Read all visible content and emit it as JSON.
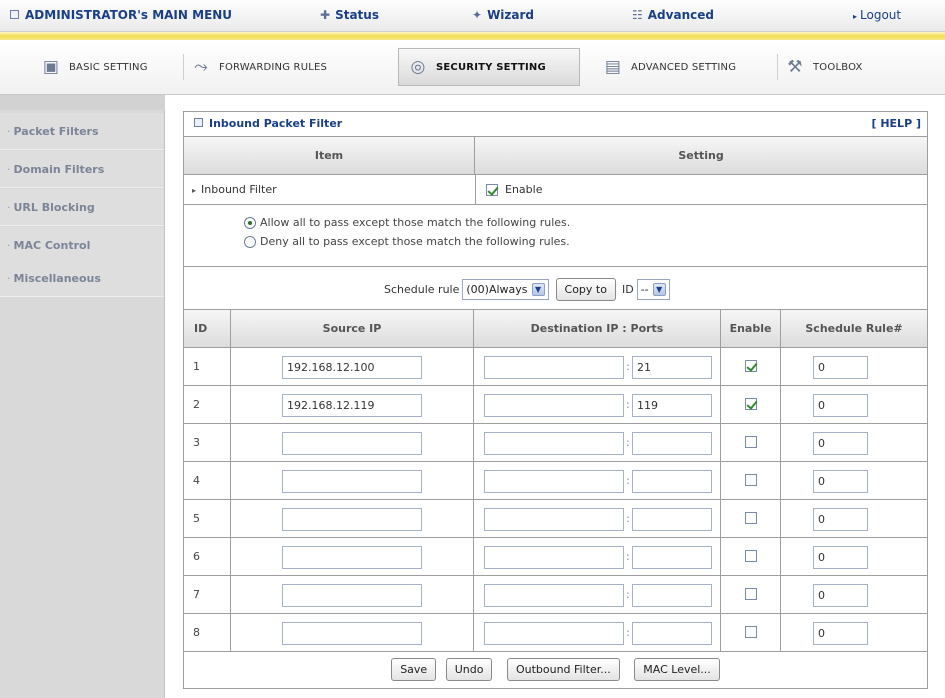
{
  "topbar": {
    "title": "ADMINISTRATOR's MAIN MENU",
    "status": "Status",
    "wizard": "Wizard",
    "advanced": "Advanced",
    "logout": "Logout"
  },
  "tabs": {
    "basic": "BASIC SETTING",
    "forwarding": "FORWARDING RULES",
    "security": "SECURITY SETTING",
    "advanced": "ADVANCED SETTING",
    "toolbox": "TOOLBOX",
    "active": "security"
  },
  "sidebar": {
    "items": [
      {
        "label": "Packet Filters"
      },
      {
        "label": "Domain Filters"
      },
      {
        "label": "URL Blocking"
      },
      {
        "label": "MAC Control"
      },
      {
        "label": "Miscellaneous"
      }
    ]
  },
  "panel": {
    "title": "Inbound Packet Filter",
    "help": "[ HELP ]",
    "col_item": "Item",
    "col_setting": "Setting",
    "inbound_label": "Inbound Filter",
    "inbound_enable_label": "Enable",
    "inbound_enabled": true,
    "radio_allow": "Allow all to pass except those match the following rules.",
    "radio_deny": "Deny all to pass except those match the following rules.",
    "policy": "allow",
    "schedule_label": "Schedule rule",
    "schedule_value": "(00)Always",
    "copy_to": "Copy to",
    "id_label": "ID",
    "id_value": "--"
  },
  "rules": {
    "headers": {
      "id": "ID",
      "source_ip": "Source IP",
      "destination": "Destination IP : Ports",
      "enable": "Enable",
      "schedule": "Schedule Rule#"
    },
    "rows": [
      {
        "id": "1",
        "source_ip": "192.168.12.100",
        "dest_ip": "",
        "port": "21",
        "enabled": true,
        "schedule": "0"
      },
      {
        "id": "2",
        "source_ip": "192.168.12.119",
        "dest_ip": "",
        "port": "119",
        "enabled": true,
        "schedule": "0"
      },
      {
        "id": "3",
        "source_ip": "",
        "dest_ip": "",
        "port": "",
        "enabled": false,
        "schedule": "0"
      },
      {
        "id": "4",
        "source_ip": "",
        "dest_ip": "",
        "port": "",
        "enabled": false,
        "schedule": "0"
      },
      {
        "id": "5",
        "source_ip": "",
        "dest_ip": "",
        "port": "",
        "enabled": false,
        "schedule": "0"
      },
      {
        "id": "6",
        "source_ip": "",
        "dest_ip": "",
        "port": "",
        "enabled": false,
        "schedule": "0"
      },
      {
        "id": "7",
        "source_ip": "",
        "dest_ip": "",
        "port": "",
        "enabled": false,
        "schedule": "0"
      },
      {
        "id": "8",
        "source_ip": "",
        "dest_ip": "",
        "port": "",
        "enabled": false,
        "schedule": "0"
      }
    ]
  },
  "buttons": {
    "save": "Save",
    "undo": "Undo",
    "outbound": "Outbound Filter...",
    "mac_level": "MAC Level..."
  },
  "colors": {
    "link_blue": "#1a3f86",
    "gold": "#f3dc53",
    "sidebar_bg": "#d9d9d9",
    "check_green": "#2d8a2d"
  }
}
